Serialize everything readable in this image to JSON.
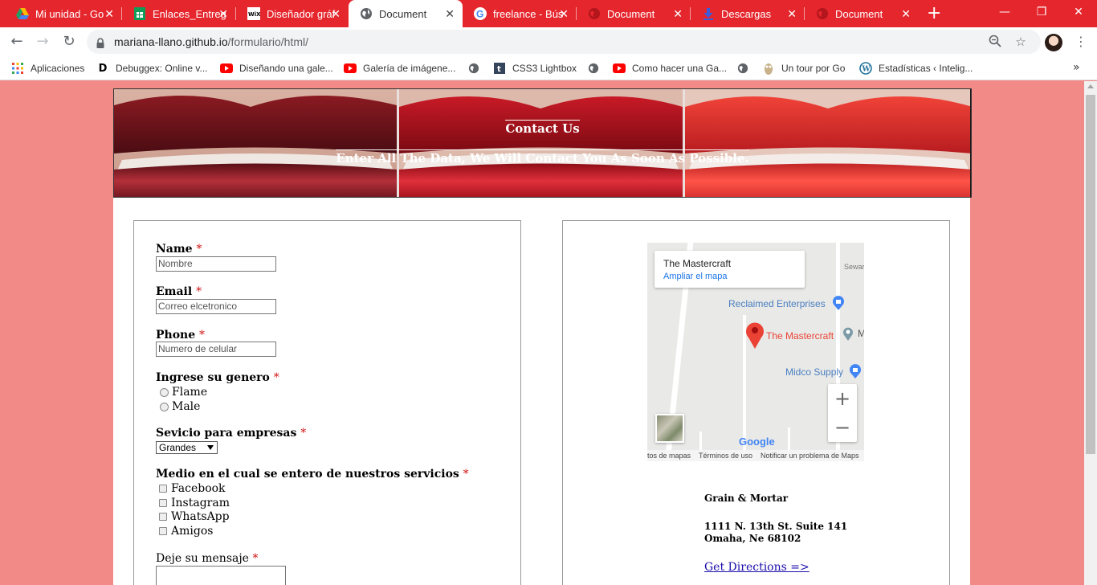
{
  "browser": {
    "tabs": [
      {
        "title": "Mi unidad - Go",
        "icon": "google-drive-icon"
      },
      {
        "title": "Enlaces_Entreg",
        "icon": "google-sheets-icon"
      },
      {
        "title": "Diseñador gráf",
        "icon": "wix-icon"
      },
      {
        "title": "Document",
        "icon": "globe-icon"
      },
      {
        "title": "freelance - Bús",
        "icon": "google-icon"
      },
      {
        "title": "Document",
        "icon": "globe-icon"
      },
      {
        "title": "Descargas",
        "icon": "download-icon"
      },
      {
        "title": "Document",
        "icon": "globe-icon"
      }
    ],
    "url_host": "mariana-llano.github.io",
    "url_path": "/formulario/html/",
    "bookmarks": [
      {
        "label": "Aplicaciones",
        "icon": "apps-grid-icon"
      },
      {
        "label": "Debuggex: Online v...",
        "icon": "debuggex-icon"
      },
      {
        "label": "Diseñando una gale...",
        "icon": "youtube-icon"
      },
      {
        "label": "Galería de imágene...",
        "icon": "youtube-icon"
      },
      {
        "label": "",
        "icon": "globe-icon"
      },
      {
        "label": "CSS3 Lightbox",
        "icon": "tumblr-icon"
      },
      {
        "label": "",
        "icon": "globe-icon"
      },
      {
        "label": "Como hacer una Ga...",
        "icon": "youtube-icon"
      },
      {
        "label": "",
        "icon": "globe-icon"
      },
      {
        "label": "Un tour por Go",
        "icon": "gopher-icon"
      },
      {
        "label": "Estadísticas ‹ Intelig...",
        "icon": "wordpress-icon"
      }
    ],
    "bookmarks_more": "»"
  },
  "banner": {
    "title": "Contact Us",
    "subtitle": "Enter All The Data, We Will Contact You As Soon As Possible."
  },
  "form": {
    "name_label": "Name",
    "name_placeholder": "Nombre",
    "email_label": "Email",
    "email_placeholder": "Correo elcetronico",
    "phone_label": "Phone",
    "phone_placeholder": "Numero de celular",
    "gender_label": "Ingrese su genero",
    "gender_options": [
      "Flame",
      "Male"
    ],
    "service_label": "Sevicio para empresas",
    "service_selected": "Grandes",
    "medium_label": "Medio en el cual se entero de nuestros servicios",
    "medium_options": [
      "Facebook",
      "Instagram",
      "WhatsApp",
      "Amigos"
    ],
    "message_label": "Deje su mensaje",
    "required_mark": "*"
  },
  "map": {
    "place_name": "The Mastercraft",
    "enlarge_link": "Ampliar el mapa",
    "poi_1": "Reclaimed Enterprises",
    "poi_2": "The Mastercraft",
    "poi_3": "Midco Supply",
    "street_partial": "Sewar",
    "poi_partial": "M",
    "google_logo": "Google",
    "footer_data": "tos de mapas",
    "footer_terms": "Términos de uso",
    "footer_report": "Notificar un problema de Maps",
    "zoom_in": "+",
    "zoom_out": "−"
  },
  "address": {
    "name": "Grain & Mortar",
    "line1": "1111 N. 13th St. Suite 141",
    "line2": "Omaha, Ne 68102",
    "directions_link": "Get Directions =>"
  },
  "colors": {
    "tabbar": "#e5262d",
    "page_bg": "#f28b87",
    "required": "#d01010",
    "link": "#1a0dab"
  }
}
